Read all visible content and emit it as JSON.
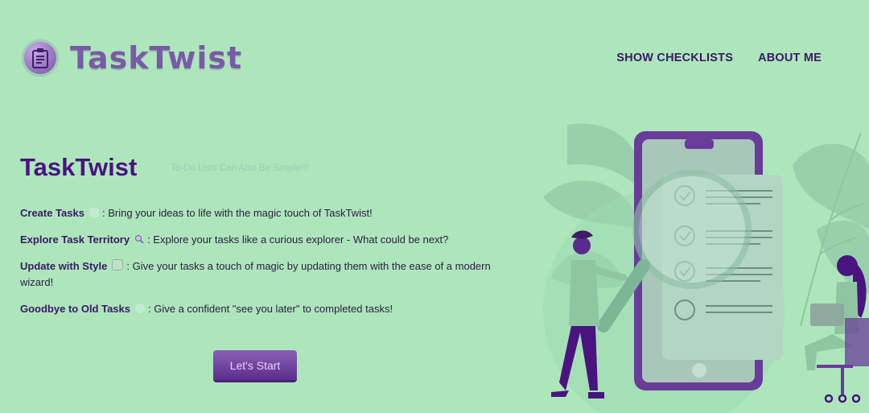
{
  "header": {
    "logo_text": "TaskTwist",
    "nav": [
      "SHOW CHECKLISTS",
      "ABOUT ME"
    ]
  },
  "hero": {
    "title": "TaskTwist",
    "subtitle": "To-Do Lists Can Also Be Simple!!!",
    "features": [
      {
        "label": "Create Tasks",
        "icon": "sparkle-emoji",
        "text": ": Bring your ideas to life with the magic touch of TaskTwist!"
      },
      {
        "label": "Explore Task Territory",
        "icon": "magnifier-emoji",
        "text": ": Explore your tasks like a curious explorer - What could be next?"
      },
      {
        "label": "Update with Style",
        "icon": "checkbox-emoji",
        "text": ": Give your tasks a touch of magic by updating them with the ease of a modern wizard!"
      },
      {
        "label": "Goodbye to Old Tasks",
        "icon": "wave-emoji",
        "text": ": Give a confident \"see you later\" to completed tasks!"
      }
    ],
    "cta_label": "Let's Start"
  },
  "colors": {
    "background": "#ade6bb",
    "primary": "#4a1380",
    "button": "#6a3a9c"
  }
}
